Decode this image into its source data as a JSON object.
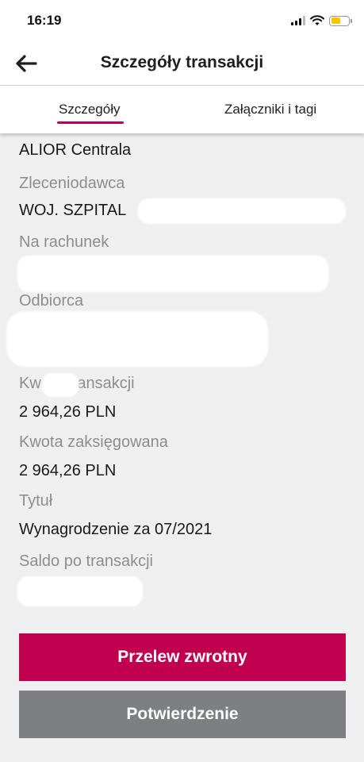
{
  "status_bar": {
    "time": "16:19"
  },
  "nav": {
    "title": "Szczegóły transakcji"
  },
  "tabs": [
    {
      "label": "Szczegóły",
      "active": true
    },
    {
      "label": "Załączniki i tagi",
      "active": false
    }
  ],
  "details": {
    "bank_name": "ALIOR Centrala",
    "orderer_label": "Zleceniodawca",
    "orderer_value": "WOJ. SZPITAL",
    "account_label": "Na rachunek",
    "recipient_label": "Odbiorca",
    "amount_label": "Kwota transakcji",
    "amount_value": "2 964,26 PLN",
    "booked_label": "Kwota zaksięgowana",
    "booked_value": "2 964,26 PLN",
    "title_label": "Tytuł",
    "title_value": "Wynagrodzenie za 07/2021",
    "balance_label": "Saldo po transakcji"
  },
  "buttons": {
    "return_transfer": "Przelew zwrotny",
    "confirmation": "Potwierdzenie"
  },
  "colors": {
    "accent": "#c0004e",
    "secondary_button": "#7e7f83",
    "background": "#efefef"
  }
}
